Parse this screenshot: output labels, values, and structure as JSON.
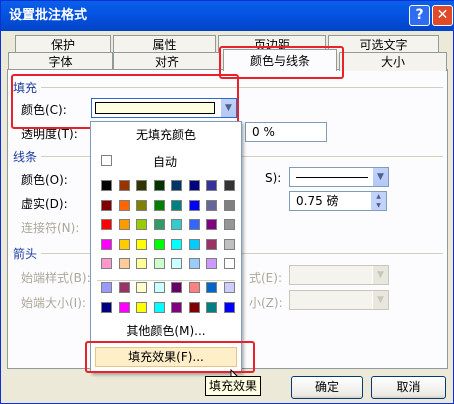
{
  "window": {
    "title": "设置批注格式",
    "help_icon": "?",
    "close_icon": "✕"
  },
  "tabs_row1": [
    {
      "label": "保护"
    },
    {
      "label": "属性"
    },
    {
      "label": "页边距"
    },
    {
      "label": "可选文字"
    }
  ],
  "tabs_row2": [
    {
      "label": "字体"
    },
    {
      "label": "对齐"
    },
    {
      "label": "颜色与线条",
      "active": true
    },
    {
      "label": "大小"
    }
  ],
  "fill": {
    "section": "填充",
    "color_label": "颜色(C):",
    "transparency_label": "透明度(T):",
    "transparency_value": "0 %"
  },
  "line": {
    "section": "线条",
    "color_label": "颜色(O):",
    "dash_label": "虚实(D):",
    "connector_label": "连接符(N):",
    "style_label_fragment": "S):",
    "weight_value": "0.75 磅"
  },
  "arrows": {
    "section": "箭头",
    "begin_style_label": "始端样式(B):",
    "begin_size_label": "始端大小(I):",
    "end_style_fragment": "式(E):",
    "end_size_fragment": "小(Z):"
  },
  "popup": {
    "no_fill": "无填充颜色",
    "automatic": "自动",
    "more_colors": "其他颜色(M)...",
    "fill_effects": "填充效果(F)..."
  },
  "palette": {
    "rows": [
      [
        "#000000",
        "#993300",
        "#333300",
        "#003300",
        "#003366",
        "#000080",
        "#333399",
        "#333333"
      ],
      [
        "#800000",
        "#FF6600",
        "#808000",
        "#008000",
        "#008080",
        "#0000FF",
        "#666699",
        "#808080"
      ],
      [
        "#FF0000",
        "#FF9900",
        "#99CC00",
        "#339966",
        "#33CCCC",
        "#3366FF",
        "#800080",
        "#969696"
      ],
      [
        "#FF00FF",
        "#FFCC00",
        "#FFFF00",
        "#00FF00",
        "#00FFFF",
        "#00CCFF",
        "#993366",
        "#C0C0C0"
      ],
      [
        "#FF99CC",
        "#FFCC99",
        "#FFFF99",
        "#CCFFCC",
        "#CCFFFF",
        "#99CCFF",
        "#CC99FF",
        "#FFFFFF"
      ]
    ],
    "rows2": [
      [
        "#9999FF",
        "#993366",
        "#FFFFCC",
        "#CCFFFF",
        "#660066",
        "#FF8080",
        "#0066CC",
        "#CCCCFF"
      ],
      [
        "#000080",
        "#FF00FF",
        "#FFFF00",
        "#00FFFF",
        "#800080",
        "#800000",
        "#008080",
        "#0000FF"
      ]
    ]
  },
  "tooltip": "填充效果",
  "buttons": {
    "ok": "确定",
    "cancel": "取消"
  }
}
